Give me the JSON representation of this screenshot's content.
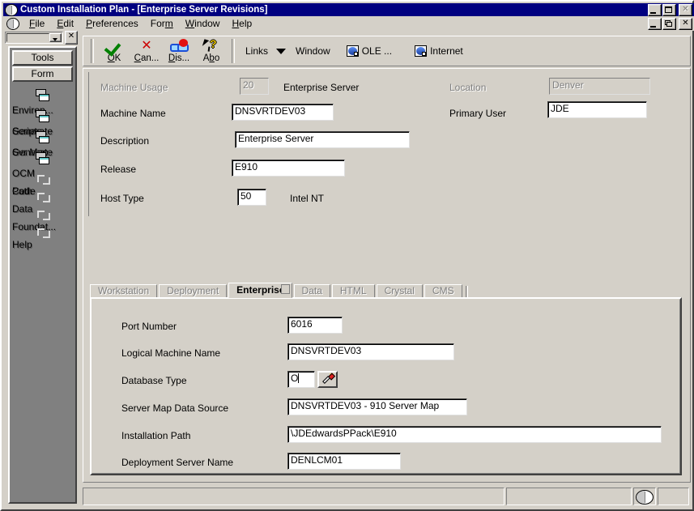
{
  "window": {
    "title": "Custom Installation Plan - [Enterprise Server Revisions]",
    "icon": "globe-icon",
    "buttons": {
      "minimize": "_",
      "maximize": "□",
      "close": "✕",
      "child_restore": "❐",
      "child_minimize": "_",
      "child_close": "✕"
    }
  },
  "menubar": {
    "icon": "globe-icon",
    "items": [
      {
        "label": "File",
        "mnemonic": "F"
      },
      {
        "label": "Edit",
        "mnemonic": "E"
      },
      {
        "label": "Preferences",
        "mnemonic": "P"
      },
      {
        "label": "Form",
        "mnemonic": "m"
      },
      {
        "label": "Window",
        "mnemonic": "W"
      },
      {
        "label": "Help",
        "mnemonic": "H"
      }
    ]
  },
  "fastpath": {
    "value": "",
    "placeholder": "",
    "close_label": "✕"
  },
  "toolbar": {
    "buttons": [
      {
        "label": "OK",
        "mnemonic": "O",
        "icon": "green-check-icon"
      },
      {
        "label": "Can...",
        "mnemonic": "C",
        "icon": "red-x-icon"
      },
      {
        "label": "Dis...",
        "mnemonic": "D",
        "icon": "display-glasses-icon"
      },
      {
        "label": "Abo",
        "mnemonic": "b",
        "icon": "about-help-arrow-icon"
      }
    ],
    "links_label": "Links",
    "window_label": "Window",
    "ole_label": "OLE ...",
    "internet_label": "Internet"
  },
  "exitbar": {
    "tabs": [
      {
        "label": "Tools"
      },
      {
        "label": "Form"
      }
    ],
    "items": [
      {
        "label": "Environ...",
        "icon": "pages-icon",
        "enabled": true
      },
      {
        "label_line1": "Generate",
        "label_line2": "Scripts",
        "icon": "pages-icon",
        "enabled": true
      },
      {
        "label_line1": "Generate",
        "label_line2": "Svr Map",
        "icon": "pages-icon",
        "enabled": true
      },
      {
        "label": "OCM",
        "icon": "pages-icon",
        "enabled": true
      },
      {
        "label_line1": "Path",
        "label_line2": "Code",
        "icon": "bracket-icon",
        "enabled": false
      },
      {
        "label": "Data",
        "icon": "bracket-icon",
        "enabled": false
      },
      {
        "label": "Foundat...",
        "icon": "bracket-icon",
        "enabled": false
      },
      {
        "label": "Help",
        "icon": "bracket-icon",
        "enabled": false
      }
    ]
  },
  "header_form": {
    "machine_usage": {
      "label": "Machine Usage",
      "value": "20",
      "description": "Enterprise Server",
      "disabled": true
    },
    "location": {
      "label": "Location",
      "value": "Denver",
      "disabled": true
    },
    "machine_name": {
      "label": "Machine Name",
      "value": "DNSVRTDEV03"
    },
    "primary_user": {
      "label": "Primary User",
      "value": "JDE"
    },
    "description": {
      "label": "Description",
      "value": "Enterprise Server"
    },
    "release": {
      "label": "Release",
      "value": "E910"
    },
    "host_type": {
      "label": "Host Type",
      "value": "50",
      "description": "Intel NT"
    }
  },
  "tabs": [
    {
      "label": "Workstation",
      "active": false
    },
    {
      "label": "Deployment",
      "active": false
    },
    {
      "label": "Enterprise",
      "active": true
    },
    {
      "label": "Data",
      "active": false
    },
    {
      "label": "HTML",
      "active": false
    },
    {
      "label": "Crystal",
      "active": false
    },
    {
      "label": "CMS",
      "active": false
    }
  ],
  "enterprise_tab": {
    "port_number": {
      "label": "Port Number",
      "value": "6016"
    },
    "logical_machine_name": {
      "label": "Logical Machine Name",
      "value": "DNSVRTDEV03"
    },
    "database_type": {
      "label": "Database Type",
      "value": "O",
      "assist_icon": "flashlight-icon"
    },
    "server_map_data_source": {
      "label": "Server Map Data Source",
      "value": "DNSVRTDEV03 - 910 Server Map"
    },
    "installation_path": {
      "label": "Installation Path",
      "value": "\\JDEdwardsPPack\\E910"
    },
    "deployment_server_name": {
      "label": "Deployment Server Name",
      "value": "DENLCM01"
    }
  },
  "statusbar": {
    "pane1": "",
    "pane2": "",
    "icon": "globe-icon",
    "pane3": ""
  },
  "colors": {
    "titlebar": "#000080",
    "face": "#d4d0c8",
    "exitbar": "#808080",
    "disabled_text": "#808080",
    "ok_icon": "#008000",
    "cancel_icon": "#cc0000"
  }
}
